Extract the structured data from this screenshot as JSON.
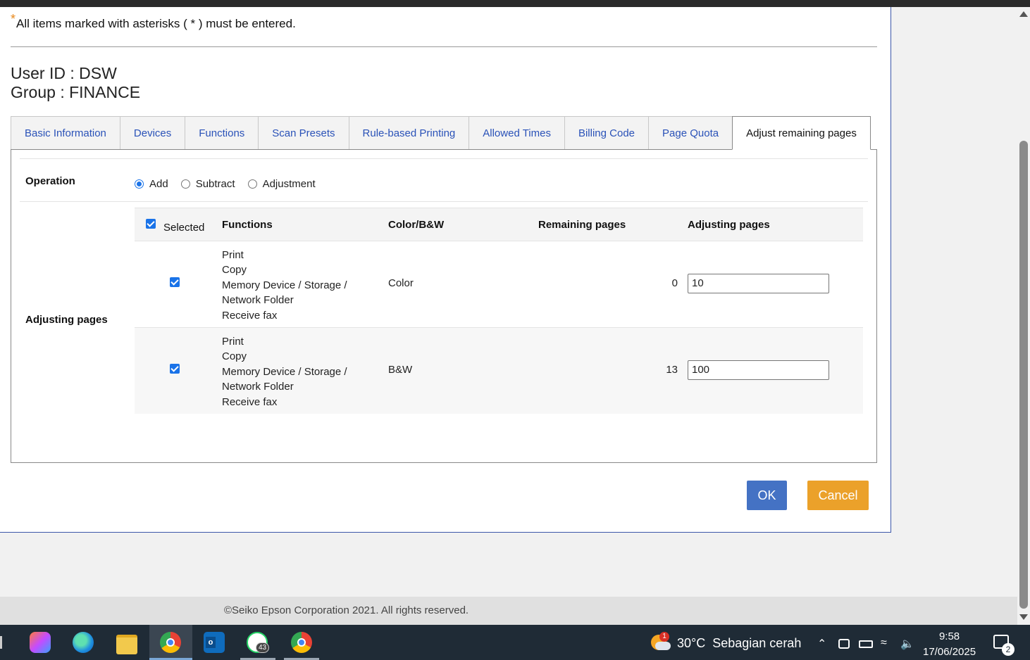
{
  "note": {
    "asterisk": "*",
    "text": "All items marked with asterisks ( * ) must be entered."
  },
  "user": {
    "user_id": "User ID : DSW",
    "group": "Group : FINANCE"
  },
  "tabs": [
    {
      "label": "Basic Information",
      "active": false
    },
    {
      "label": "Devices",
      "active": false
    },
    {
      "label": "Functions",
      "active": false
    },
    {
      "label": "Scan Presets",
      "active": false
    },
    {
      "label": "Rule-based Printing",
      "active": false
    },
    {
      "label": "Allowed Times",
      "active": false
    },
    {
      "label": "Billing Code",
      "active": false
    },
    {
      "label": "Page Quota",
      "active": false
    },
    {
      "label": "Adjust remaining pages",
      "active": true
    }
  ],
  "operation": {
    "label": "Operation",
    "options": [
      {
        "label": "Add",
        "checked": true
      },
      {
        "label": "Subtract",
        "checked": false
      },
      {
        "label": "Adjustment",
        "checked": false
      }
    ]
  },
  "adjusting": {
    "label": "Adjusting pages",
    "headers": {
      "selected": "Selected",
      "functions": "Functions",
      "color": "Color/B&W",
      "remaining": "Remaining pages",
      "adjusting": "Adjusting pages"
    },
    "rows": [
      {
        "checked": true,
        "functions": [
          "Print",
          "Copy",
          "Memory Device / Storage /",
          "Network Folder",
          "Receive fax"
        ],
        "color": "Color",
        "remaining": "0",
        "adjusting": "10"
      },
      {
        "checked": true,
        "functions": [
          "Print",
          "Copy",
          "Memory Device / Storage /",
          "Network Folder",
          "Receive fax"
        ],
        "color": "B&W",
        "remaining": "13",
        "adjusting": "100"
      }
    ]
  },
  "buttons": {
    "ok": "OK",
    "cancel": "Cancel"
  },
  "footer": {
    "copyright": "©Seiko Epson Corporation 2021. All rights reserved."
  },
  "taskbar": {
    "weather_temp": "30°C",
    "weather_desc": "Sebagian cerah",
    "weather_badge": "1",
    "whatsapp_badge": "43",
    "notification_badge": "2",
    "time": "9:58",
    "date": "17/06/2025"
  }
}
